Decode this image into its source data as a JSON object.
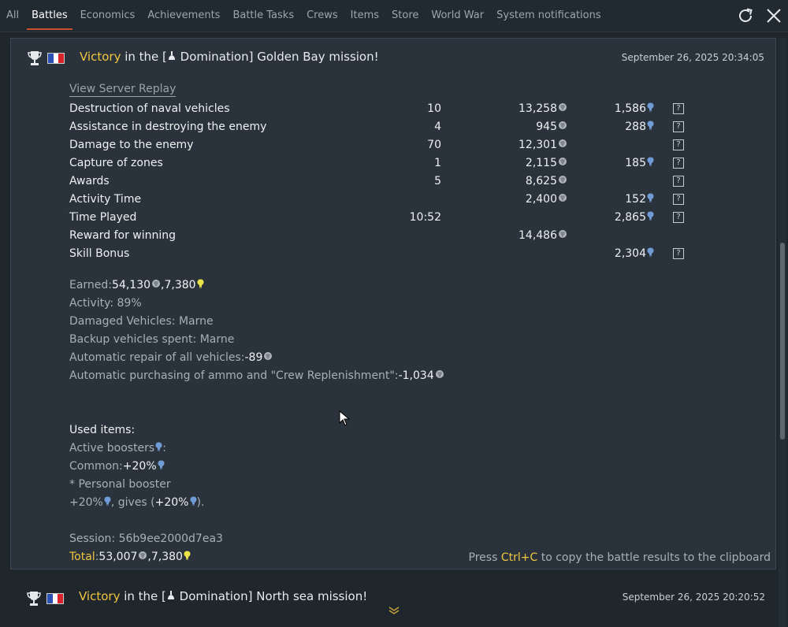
{
  "tabs": [
    {
      "label": "All"
    },
    {
      "label": "Battles",
      "active": true
    },
    {
      "label": "Economics"
    },
    {
      "label": "Achievements"
    },
    {
      "label": "Battle Tasks"
    },
    {
      "label": "Crews"
    },
    {
      "label": "Items"
    },
    {
      "label": "Store"
    },
    {
      "label": "World War"
    },
    {
      "label": "System notifications"
    }
  ],
  "message1": {
    "result": "Victory",
    "text_pre": " in the [",
    "text_post": " Domination] Golden Bay mission!",
    "datetime": "September 26, 2025 20:34:05",
    "replay_label": "View Server Replay",
    "rows": [
      {
        "label": "Destruction of naval vehicles",
        "count": "10",
        "silver": "13,258",
        "rp": "1,586",
        "help": "?"
      },
      {
        "label": "Assistance in destroying the enemy",
        "count": "4",
        "silver": "945",
        "rp": "288",
        "help": "?"
      },
      {
        "label": "Damage to the enemy",
        "count": "70",
        "silver": "12,301",
        "rp": "",
        "help": "?"
      },
      {
        "label": "Capture of zones",
        "count": "1",
        "silver": "2,115",
        "rp": "185",
        "help": "?"
      },
      {
        "label": "Awards",
        "count": "5",
        "silver": "8,625",
        "rp": "",
        "help": "?"
      },
      {
        "label": "Activity Time",
        "count": "",
        "silver": "2,400",
        "rp": "152",
        "help": "?"
      },
      {
        "label": "Time Played",
        "count": "10:52",
        "silver": "",
        "rp": "2,865",
        "help": "?"
      },
      {
        "label": "Reward for winning",
        "count": "",
        "silver": "14,486",
        "rp": "",
        "help": ""
      },
      {
        "label": "Skill Bonus",
        "count": "",
        "silver": "",
        "rp": "2,304",
        "help": "?"
      }
    ],
    "summary": {
      "earned_label": "Earned: ",
      "earned_silver": "54,130",
      "earned_sep": ", ",
      "earned_rp": "7,380",
      "activity": "Activity: 89%",
      "damaged": "Damaged Vehicles: Marne",
      "backup": "Backup vehicles spent: Marne",
      "repair_label": "Automatic repair of all vehicles: ",
      "repair_value": "-89",
      "ammo_label": "Automatic purchasing of ammo and \"Crew Replenishment\": ",
      "ammo_value": "-1,034",
      "used_items": "Used items:",
      "boosters_label": "Active boosters ",
      "boosters_colon": ":",
      "common_label": "Common: ",
      "common_value": "+20%",
      "personal": "* Personal booster",
      "personal_value": "+20%",
      "gives_label": ", gives (",
      "gives_value": "+20%",
      "gives_end": ").",
      "session": "Session: 56b9ee2000d7ea3",
      "total_label": "Total",
      "total_colon": ": ",
      "total_silver": "53,007",
      "total_sep": ", ",
      "total_rp": "7,380"
    },
    "hint_pre": "Press ",
    "hint_key": "Ctrl+C",
    "hint_post": " to copy the battle results to the clipboard"
  },
  "message2": {
    "result": "Victory",
    "text_pre": " in the [",
    "text_post": " Domination] North sea mission!",
    "datetime": "September 26, 2025 20:20:52"
  },
  "colors": {
    "accent": "#c8512b",
    "gold": "#f0c640",
    "rp_blue": "#6f9bd6",
    "bulb_yellow": "#e9e24a"
  }
}
